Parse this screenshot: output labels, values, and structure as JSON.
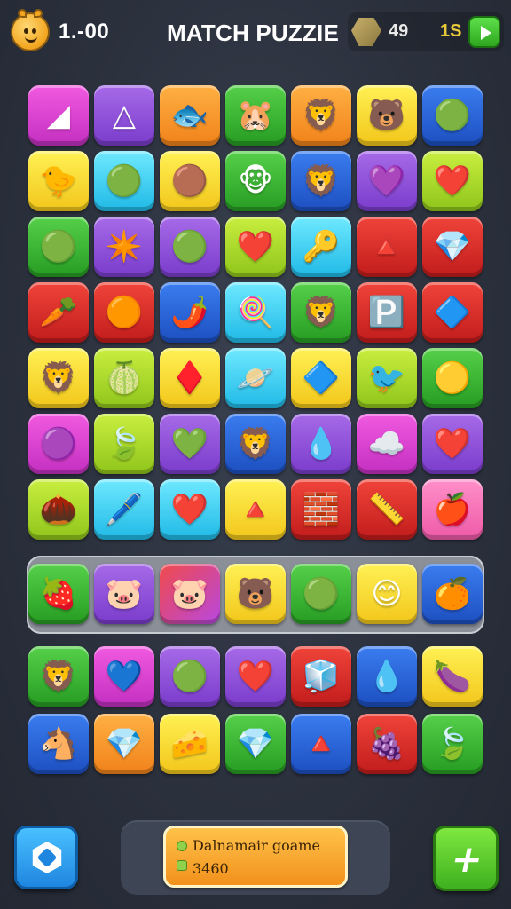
{
  "header": {
    "level": "1.-00",
    "title": "MATCH PUZZIE",
    "gems": "49",
    "coins": "1S"
  },
  "board": {
    "rows": [
      [
        {
          "color": "magenta",
          "icon": "◢",
          "name": "triangle-icon"
        },
        {
          "color": "purple",
          "icon": "△",
          "name": "triangle-outline-icon"
        },
        {
          "color": "orange",
          "icon": "🐟",
          "name": "fish-icon"
        },
        {
          "color": "green",
          "icon": "🐹",
          "name": "hamster-icon"
        },
        {
          "color": "orange",
          "icon": "🦁",
          "name": "lion-icon"
        },
        {
          "color": "yellow",
          "icon": "🐻",
          "name": "bear-icon"
        },
        {
          "color": "blue",
          "icon": "🟢",
          "name": "green-blob-icon"
        }
      ],
      [
        {
          "color": "yellow",
          "icon": "🐤",
          "name": "chick-icon"
        },
        {
          "color": "cyan",
          "icon": "🟢",
          "name": "green-ball-icon"
        },
        {
          "color": "yellow",
          "icon": "🟤",
          "name": "round-face-icon"
        },
        {
          "color": "green",
          "icon": "🐵",
          "name": "monkey-icon"
        },
        {
          "color": "blue",
          "icon": "🦁",
          "name": "lion-icon"
        },
        {
          "color": "purple",
          "icon": "💜",
          "name": "heart-icon"
        },
        {
          "color": "lime",
          "icon": "❤️",
          "name": "heart-icon"
        }
      ],
      [
        {
          "color": "green",
          "icon": "🟢",
          "name": "green-ball-icon"
        },
        {
          "color": "purple",
          "icon": "✴️",
          "name": "splat-icon"
        },
        {
          "color": "purple",
          "icon": "🟢",
          "name": "green-ball-icon"
        },
        {
          "color": "lime",
          "icon": "❤️",
          "name": "heart-icon"
        },
        {
          "color": "cyan",
          "icon": "🔑",
          "name": "key-icon"
        },
        {
          "color": "red",
          "icon": "🔺",
          "name": "gem-icon"
        },
        {
          "color": "red",
          "icon": "💎",
          "name": "crystal-icon"
        }
      ],
      [
        {
          "color": "red",
          "icon": "🥕",
          "name": "carrot-icon"
        },
        {
          "color": "red",
          "icon": "🟠",
          "name": "balloon-icon"
        },
        {
          "color": "blue",
          "icon": "🌶️",
          "name": "pepper-icon"
        },
        {
          "color": "cyan",
          "icon": "🍭",
          "name": "lollipop-icon"
        },
        {
          "color": "green",
          "icon": "🦁",
          "name": "lion-icon"
        },
        {
          "color": "red",
          "icon": "🅿️",
          "name": "letter-p-icon"
        },
        {
          "color": "red",
          "icon": "🔷",
          "name": "crystal-icon"
        }
      ],
      [
        {
          "color": "yellow",
          "icon": "🦁",
          "name": "lion-icon"
        },
        {
          "color": "lime",
          "icon": "🍈",
          "name": "melon-icon"
        },
        {
          "color": "yellow",
          "icon": "♦️",
          "name": "diamond-icon"
        },
        {
          "color": "cyan",
          "icon": "🪐",
          "name": "planet-icon"
        },
        {
          "color": "yellow",
          "icon": "🔷",
          "name": "crystal-icon"
        },
        {
          "color": "lime",
          "icon": "🐦",
          "name": "bird-icon"
        },
        {
          "color": "green",
          "icon": "🟡",
          "name": "lemon-icon"
        }
      ],
      [
        {
          "color": "magenta",
          "icon": "🟣",
          "name": "pink-ball-icon"
        },
        {
          "color": "lime",
          "icon": "🍃",
          "name": "leaf-icon"
        },
        {
          "color": "purple",
          "icon": "💚",
          "name": "heart-icon"
        },
        {
          "color": "blue",
          "icon": "🦁",
          "name": "lion-icon"
        },
        {
          "color": "purple",
          "icon": "💧",
          "name": "drop-icon"
        },
        {
          "color": "magenta",
          "icon": "☁️",
          "name": "cloud-icon"
        },
        {
          "color": "purple",
          "icon": "❤️",
          "name": "heart-icon"
        }
      ],
      [
        {
          "color": "lime",
          "icon": "🌰",
          "name": "nut-icon"
        },
        {
          "color": "cyan",
          "icon": "🖊️",
          "name": "pencil-icon"
        },
        {
          "color": "cyan",
          "icon": "❤️",
          "name": "heart-icon"
        },
        {
          "color": "yellow",
          "icon": "🔺",
          "name": "cheese-icon"
        },
        {
          "color": "red",
          "icon": "🧱",
          "name": "brick-icon"
        },
        {
          "color": "red",
          "icon": "📏",
          "name": "ruler-icon"
        },
        {
          "color": "pink",
          "icon": "🍎",
          "name": "apple-icon"
        }
      ]
    ],
    "highlight_row": [
      {
        "color": "green",
        "icon": "🍓",
        "name": "strawberry-icon"
      },
      {
        "color": "purple",
        "icon": "🐷",
        "name": "pig-icon"
      },
      {
        "color": "mixed",
        "icon": "🐷",
        "name": "pig-icon"
      },
      {
        "color": "yellow",
        "icon": "🐻",
        "name": "bear-icon"
      },
      {
        "color": "green",
        "icon": "🟢",
        "name": "green-ball-icon"
      },
      {
        "color": "yellow",
        "icon": "😊",
        "name": "smile-icon"
      },
      {
        "color": "blue",
        "icon": "🍊",
        "name": "orange-icon"
      }
    ],
    "lower_rows": [
      [
        {
          "color": "green",
          "icon": "🦁",
          "name": "lion-icon"
        },
        {
          "color": "magenta",
          "icon": "💙",
          "name": "blue-heart-icon"
        },
        {
          "color": "purple",
          "icon": "🟢",
          "name": "green-ball-icon"
        },
        {
          "color": "purple",
          "icon": "❤️",
          "name": "heart-icon"
        },
        {
          "color": "red",
          "icon": "🧊",
          "name": "ice-icon"
        },
        {
          "color": "blue",
          "icon": "💧",
          "name": "drop-icon"
        },
        {
          "color": "yellow",
          "icon": "🍆",
          "name": "eggplant-icon"
        }
      ],
      [
        {
          "color": "blue",
          "icon": "🐴",
          "name": "horse-icon"
        },
        {
          "color": "orange",
          "icon": "💎",
          "name": "pink-crystal-icon"
        },
        {
          "color": "yellow",
          "icon": "🧀",
          "name": "cheese-icon"
        },
        {
          "color": "green",
          "icon": "💎",
          "name": "blue-crystal-icon"
        },
        {
          "color": "blue",
          "icon": "🔺",
          "name": "triangle-face-icon"
        },
        {
          "color": "red",
          "icon": "🍇",
          "name": "raspberry-icon"
        },
        {
          "color": "green",
          "icon": "🍃",
          "name": "leaf-icon"
        }
      ]
    ]
  },
  "banner": {
    "line1": "Dalnamair goame",
    "line2": "3460"
  }
}
